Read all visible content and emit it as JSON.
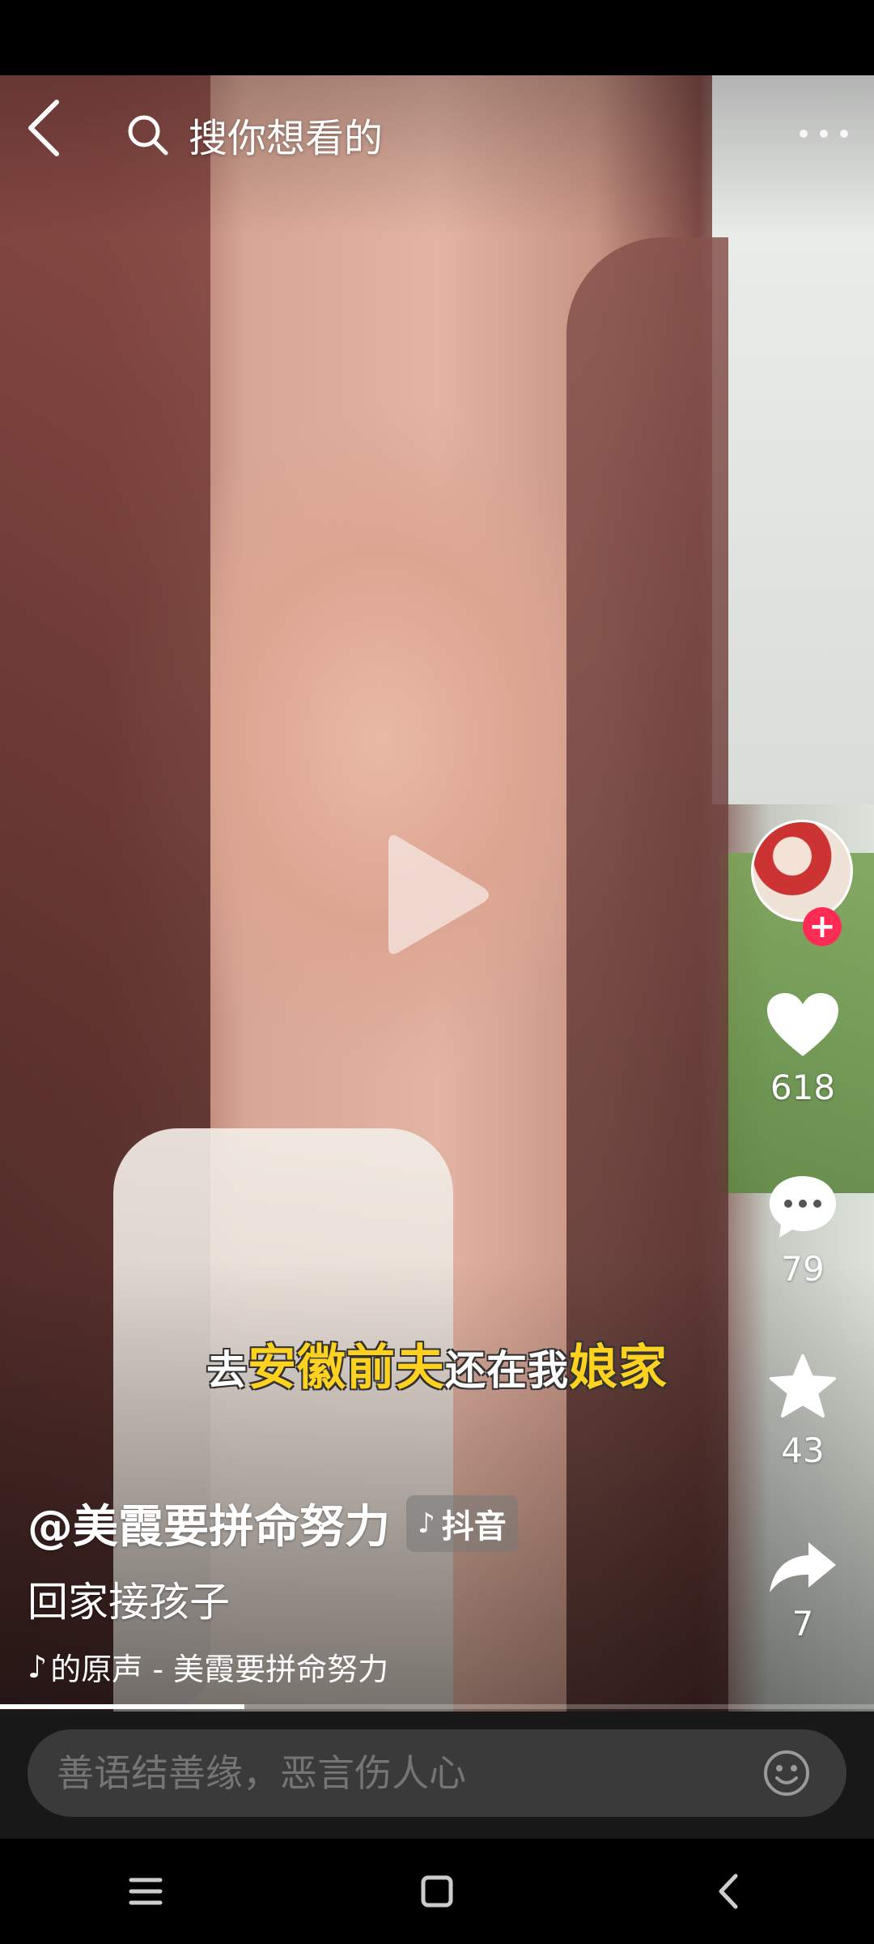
{
  "search": {
    "placeholder": "搜你想看的"
  },
  "subtitle": {
    "segments": [
      {
        "text": "去",
        "style": "white"
      },
      {
        "text": "安徽前夫",
        "style": "yellow"
      },
      {
        "text": "还在我",
        "style": "white"
      },
      {
        "text": "娘家",
        "style": "yellow"
      }
    ]
  },
  "actions": {
    "like_count": "618",
    "comment_count": "79",
    "favorite_count": "43",
    "share_count": "7"
  },
  "author": {
    "handle": "@美霞要拼命努力",
    "tag_label": "抖音"
  },
  "caption": "回家接孩子",
  "music": {
    "text": "的原声 - 美霞要拼命努力"
  },
  "progress": {
    "fraction": 0.28
  },
  "comment": {
    "placeholder": "善语结善缘，恶言伤人心"
  },
  "icons": {
    "back": "back-arrow-icon",
    "search": "search-icon",
    "more": "more-dots-icon",
    "play": "play-icon",
    "like": "heart-icon",
    "comment": "comment-bubble-icon",
    "favorite": "star-icon",
    "share": "share-arrow-icon",
    "emoji": "emoji-icon",
    "music": "music-note-icon"
  },
  "colors": {
    "accent": "#fe2c55",
    "subtitle_highlight": "#ffd21f"
  }
}
